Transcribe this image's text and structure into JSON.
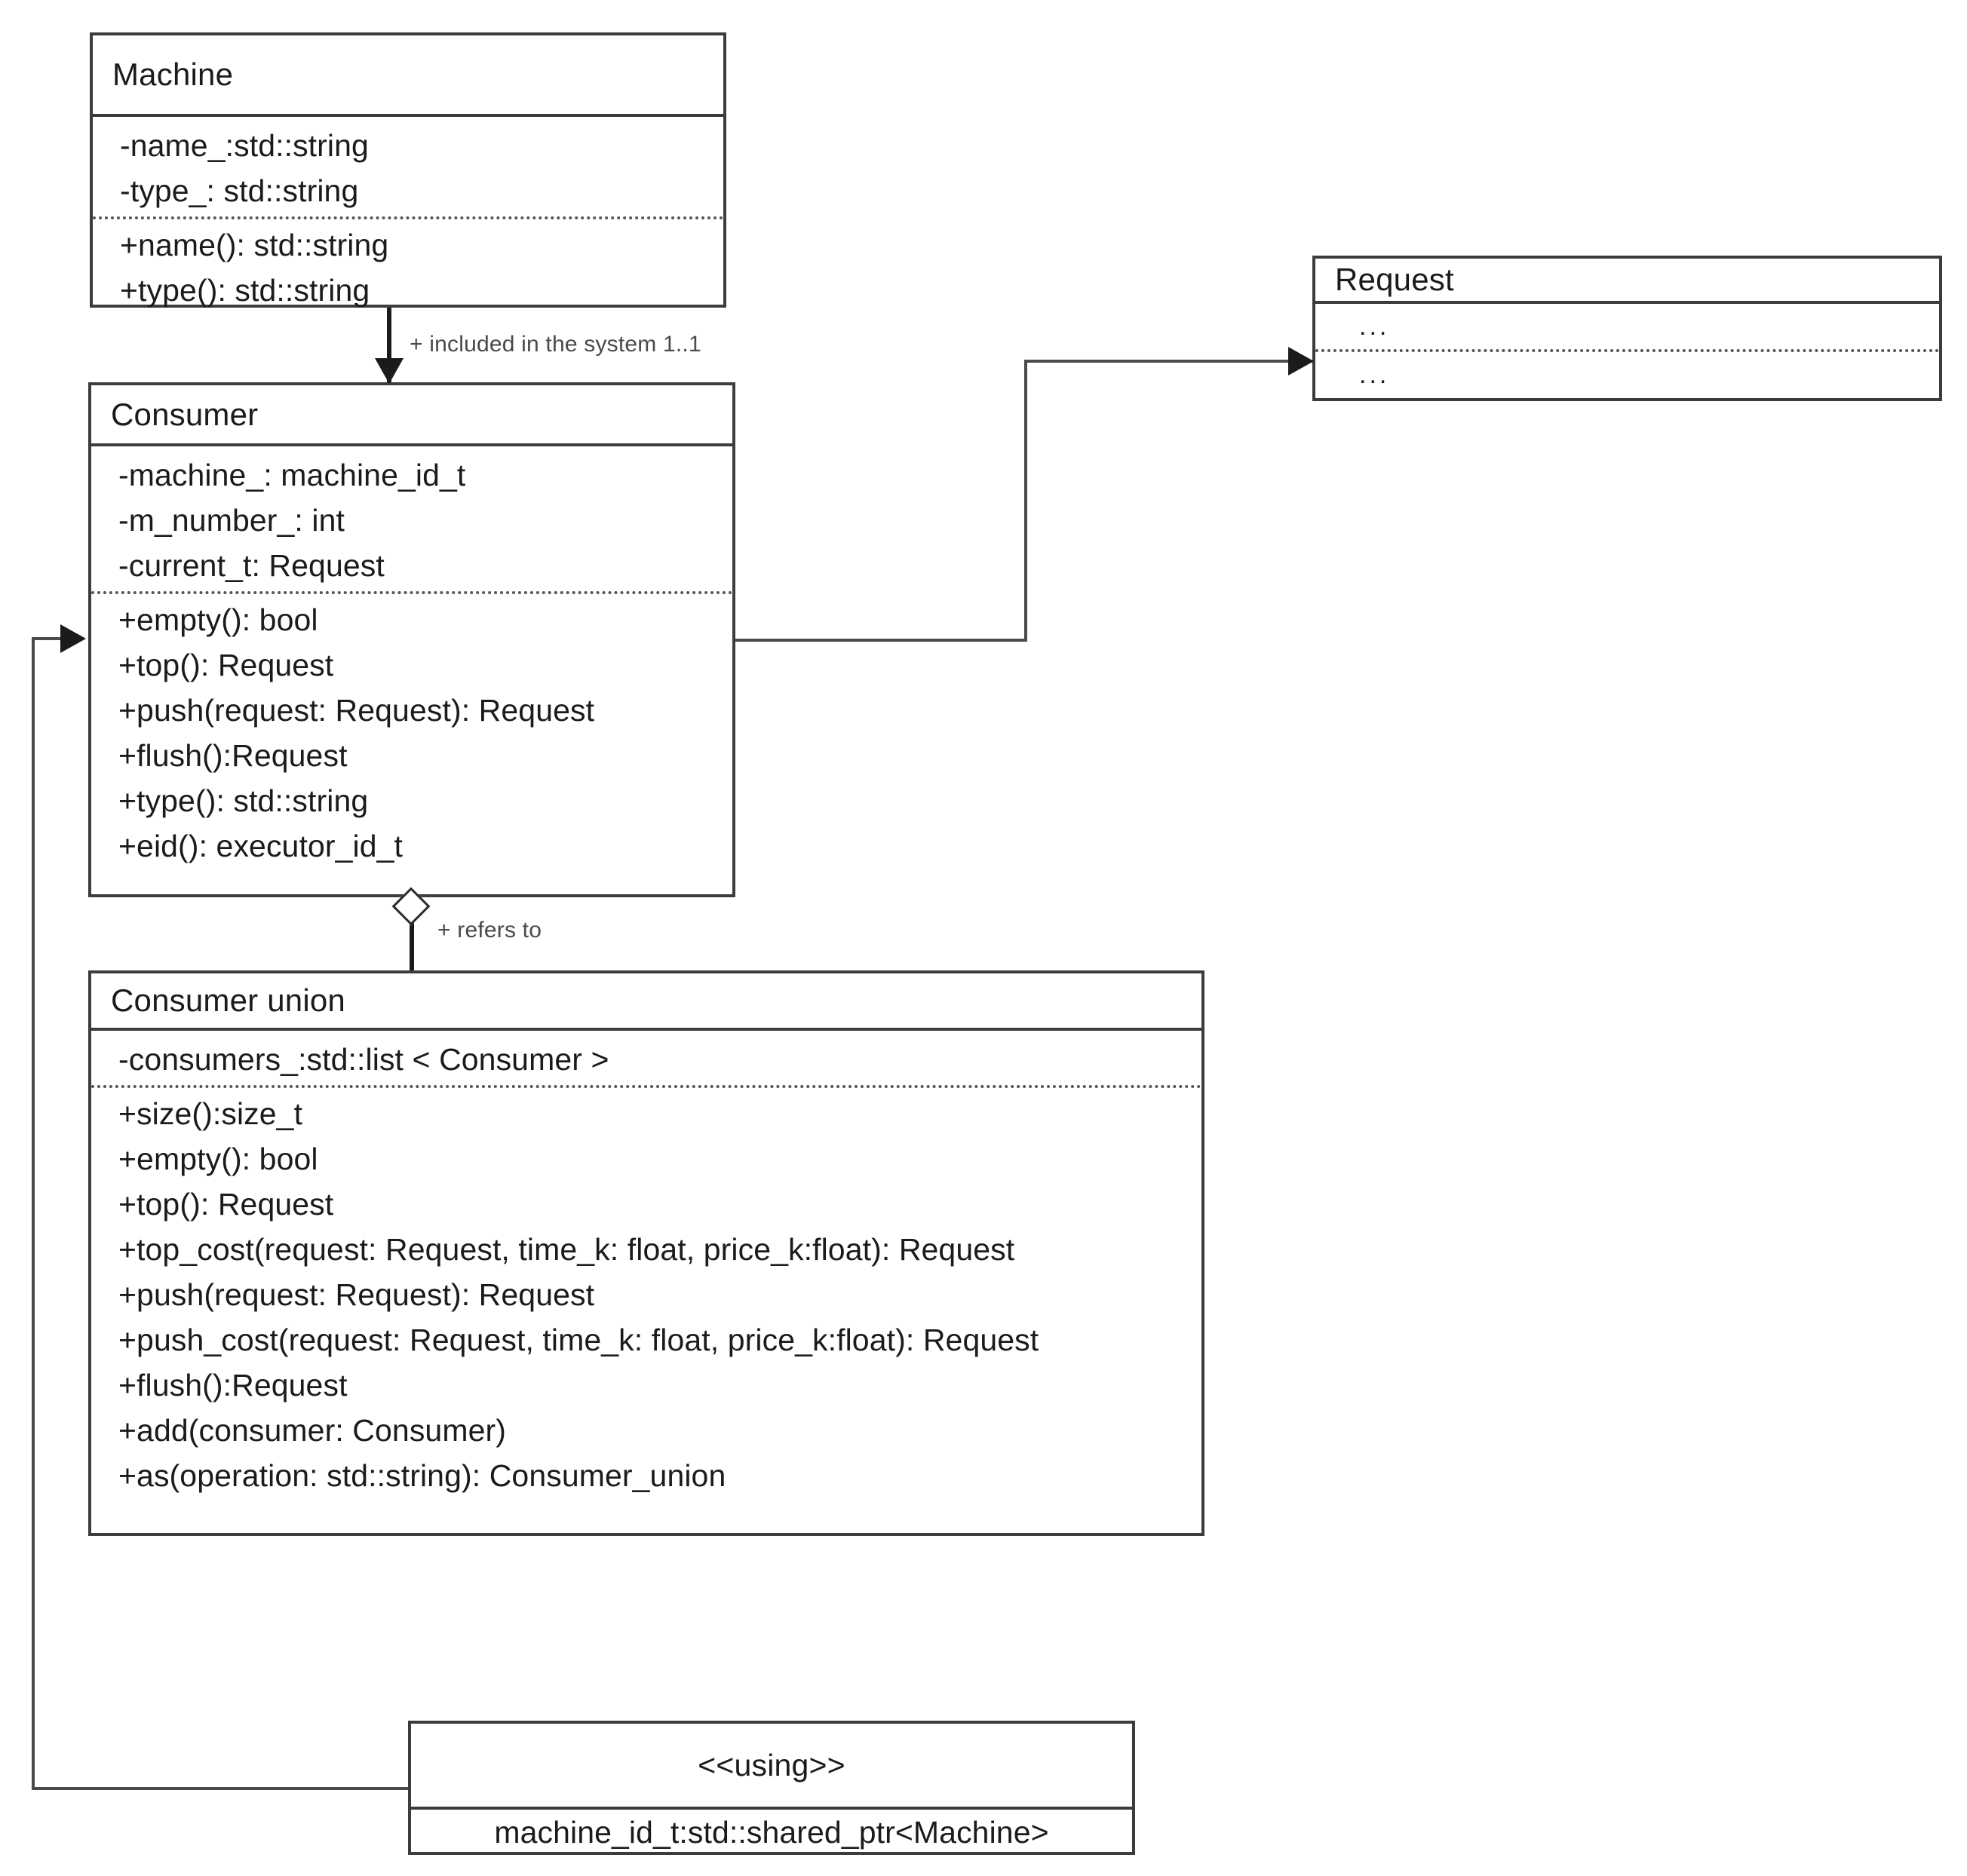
{
  "diagram": {
    "kind": "uml-class-diagram",
    "classes": [
      {
        "id": "machine",
        "name": "Machine",
        "attributes": [
          "-name_:std::string",
          "-type_: std::string"
        ],
        "operations": [
          "+name(): std::string",
          "+type(): std::string"
        ]
      },
      {
        "id": "consumer",
        "name": "Consumer",
        "attributes": [
          "-machine_: machine_id_t",
          "-m_number_: int",
          "-current_t: Request"
        ],
        "operations": [
          "+empty(): bool",
          "+top(): Request",
          "+push(request: Request): Request",
          "+flush():Request",
          "+type(): std::string",
          "+eid(): executor_id_t"
        ]
      },
      {
        "id": "request",
        "name": "Request",
        "attributes": [
          "..."
        ],
        "operations": [
          "..."
        ]
      },
      {
        "id": "consumer_union",
        "name": "Consumer union",
        "attributes": [
          "-consumers_:std::list < Consumer >"
        ],
        "operations": [
          "+size():size_t",
          "+empty(): bool",
          "+top(): Request",
          "+top_cost(request: Request, time_k: float, price_k:float): Request",
          "+push(request: Request): Request",
          "+push_cost(request: Request, time_k: float, price_k:float): Request",
          "+flush():Request",
          "+add(consumer: Consumer)",
          "+as(operation: std::string): Consumer_union"
        ]
      },
      {
        "id": "using",
        "name": "<<using>>",
        "attributes": [],
        "operations": [
          "machine_id_t:std::shared_ptr<Machine>"
        ]
      }
    ],
    "edges": [
      {
        "id": "machine-to-consumer",
        "from": "machine",
        "to": "consumer",
        "label": "+ included in the system 1..1",
        "endpoint": "filled-arrow"
      },
      {
        "id": "consumer-to-request",
        "from": "consumer",
        "to": "request",
        "label": "",
        "endpoint": "filled-arrow"
      },
      {
        "id": "consumer-union-to-consumer",
        "from": "consumer_union",
        "to": "consumer",
        "label": "+ refers to",
        "endpoint": "hollow-diamond"
      },
      {
        "id": "using-to-consumer",
        "from": "using",
        "to": "consumer",
        "label": "",
        "endpoint": "filled-arrow"
      }
    ]
  },
  "colors": {
    "border": "#3c3c3c",
    "text": "#1b1b1b",
    "line": "#4a4a4a",
    "background": "#ffffff"
  }
}
